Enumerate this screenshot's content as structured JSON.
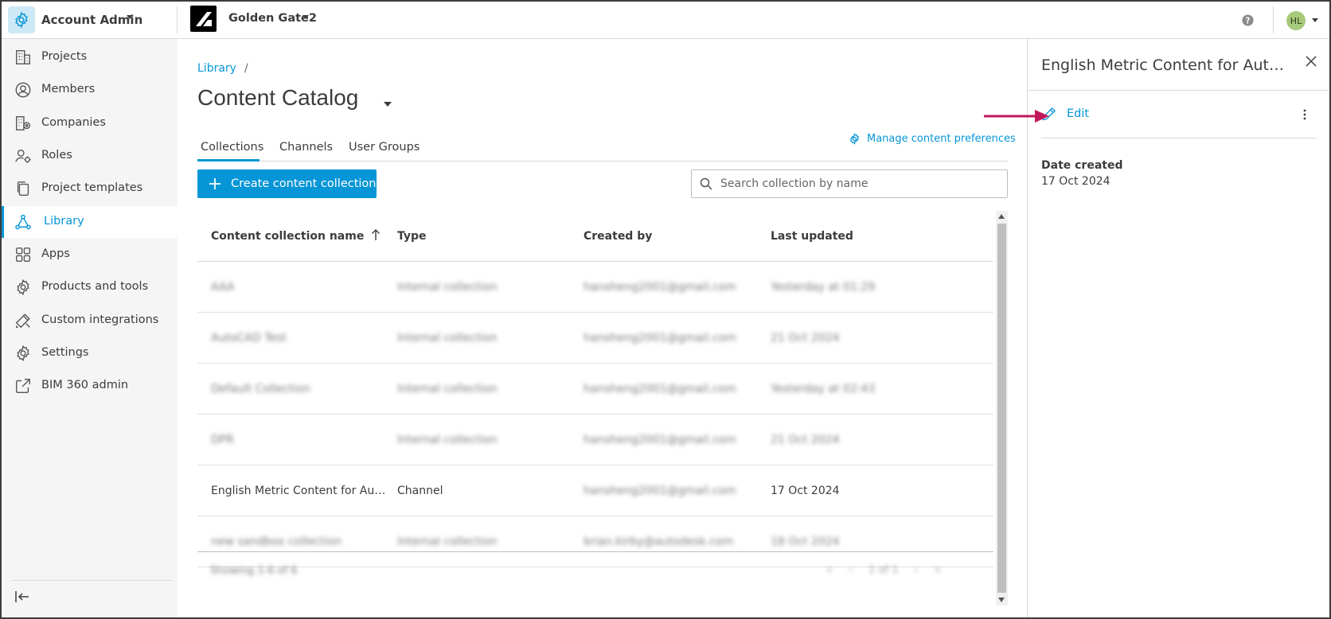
{
  "topbar": {
    "account_label": "Account Admin",
    "project_label": "Golden Gate2",
    "avatar_initials": "HL"
  },
  "sidebar": {
    "items": [
      {
        "label": "Projects",
        "icon": "building-icon"
      },
      {
        "label": "Members",
        "icon": "user-circle-icon"
      },
      {
        "label": "Companies",
        "icon": "company-icon"
      },
      {
        "label": "Roles",
        "icon": "user-gear-icon"
      },
      {
        "label": "Project templates",
        "icon": "copy-icon"
      },
      {
        "label": "Library",
        "icon": "library-icon",
        "active": true
      },
      {
        "label": "Apps",
        "icon": "apps-grid-icon"
      },
      {
        "label": "Products and tools",
        "icon": "gear-icon"
      },
      {
        "label": "Custom integrations",
        "icon": "tools-icon"
      },
      {
        "label": "Settings",
        "icon": "settings-icon"
      },
      {
        "label": "BIM 360 admin",
        "icon": "external-link-icon"
      }
    ]
  },
  "main": {
    "breadcrumb": {
      "root": "Library",
      "sep": "/"
    },
    "title": "Content Catalog",
    "tabs": [
      {
        "label": "Collections",
        "active": true
      },
      {
        "label": "Channels"
      },
      {
        "label": "User Groups"
      }
    ],
    "manage_link": "Manage content preferences",
    "create_button": "Create content collection",
    "search_placeholder": "Search collection by name",
    "table": {
      "headers": [
        "Content collection name",
        "Type",
        "Created by",
        "Last updated"
      ],
      "rows": [
        {
          "name": "AAA",
          "type": "Internal collection",
          "created_by": "hansheng2001@gmail.com",
          "updated": "Yesterday at 01:29",
          "blurred": true
        },
        {
          "name": "AutoCAD Test",
          "type": "Internal collection",
          "created_by": "hansheng2001@gmail.com",
          "updated": "21 Oct 2024",
          "blurred": true
        },
        {
          "name": "Default Collection",
          "type": "Internal collection",
          "created_by": "hansheng2001@gmail.com",
          "updated": "Yesterday at 02:43",
          "blurred": true
        },
        {
          "name": "DPR",
          "type": "Internal collection",
          "created_by": "hansheng2001@gmail.com",
          "updated": "21 Oct 2024",
          "blurred": true
        },
        {
          "name": "English Metric Content for Auto...",
          "type": "Channel",
          "created_by": "hansheng2001@gmail.com",
          "updated": "17 Oct 2024",
          "blurred": false,
          "blur_created": true
        },
        {
          "name": "new sandbox collection",
          "type": "Internal collection",
          "created_by": "brian.kirby@autodesk.com",
          "updated": "18 Oct 2024",
          "blurred": true
        }
      ],
      "footer_showing": "Showing 1-6 of 6",
      "pager_text": "1 of 1"
    }
  },
  "panel": {
    "title": "English Metric Content for Auto...",
    "edit_label": "Edit",
    "date_created_label": "Date created",
    "date_created_value": "17 Oct 2024"
  },
  "colors": {
    "accent": "#0696d7",
    "annotation_arrow": "#c2185b",
    "sidebar_bg": "#f5f5f5"
  }
}
